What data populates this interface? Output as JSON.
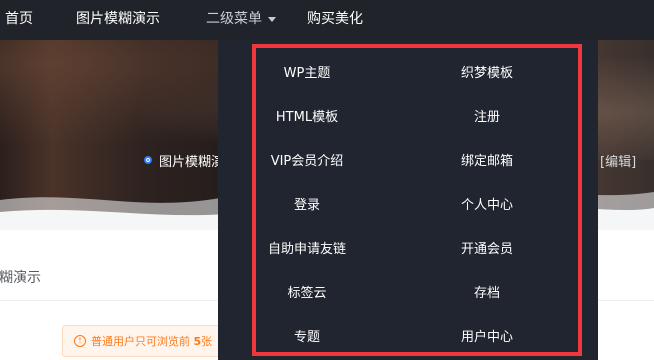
{
  "nav": {
    "items": [
      "首页",
      "图片模糊演示",
      "二级菜单",
      "购买美化"
    ]
  },
  "hero": {
    "crumb": "图片模糊演",
    "edit": "[编辑]"
  },
  "page": {
    "title": "糊演示",
    "notice": {
      "text": "普通用户只可浏览前",
      "number": "5",
      "tail": "张"
    }
  },
  "dropdown": {
    "items": [
      "WP主题",
      "织梦模板",
      "HTML模板",
      "注册",
      "VIP会员介绍",
      "绑定邮箱",
      "登录",
      "个人中心",
      "自助申请友链",
      "开通会员",
      "标签云",
      "存档",
      "专题",
      "用户中心"
    ]
  },
  "colors": {
    "nav_bg": "#20242a",
    "dropdown_bg": "#20252f",
    "highlight_border": "#f0373c",
    "notice_text": "#ff7a1a",
    "accent": "#2f7bff"
  }
}
